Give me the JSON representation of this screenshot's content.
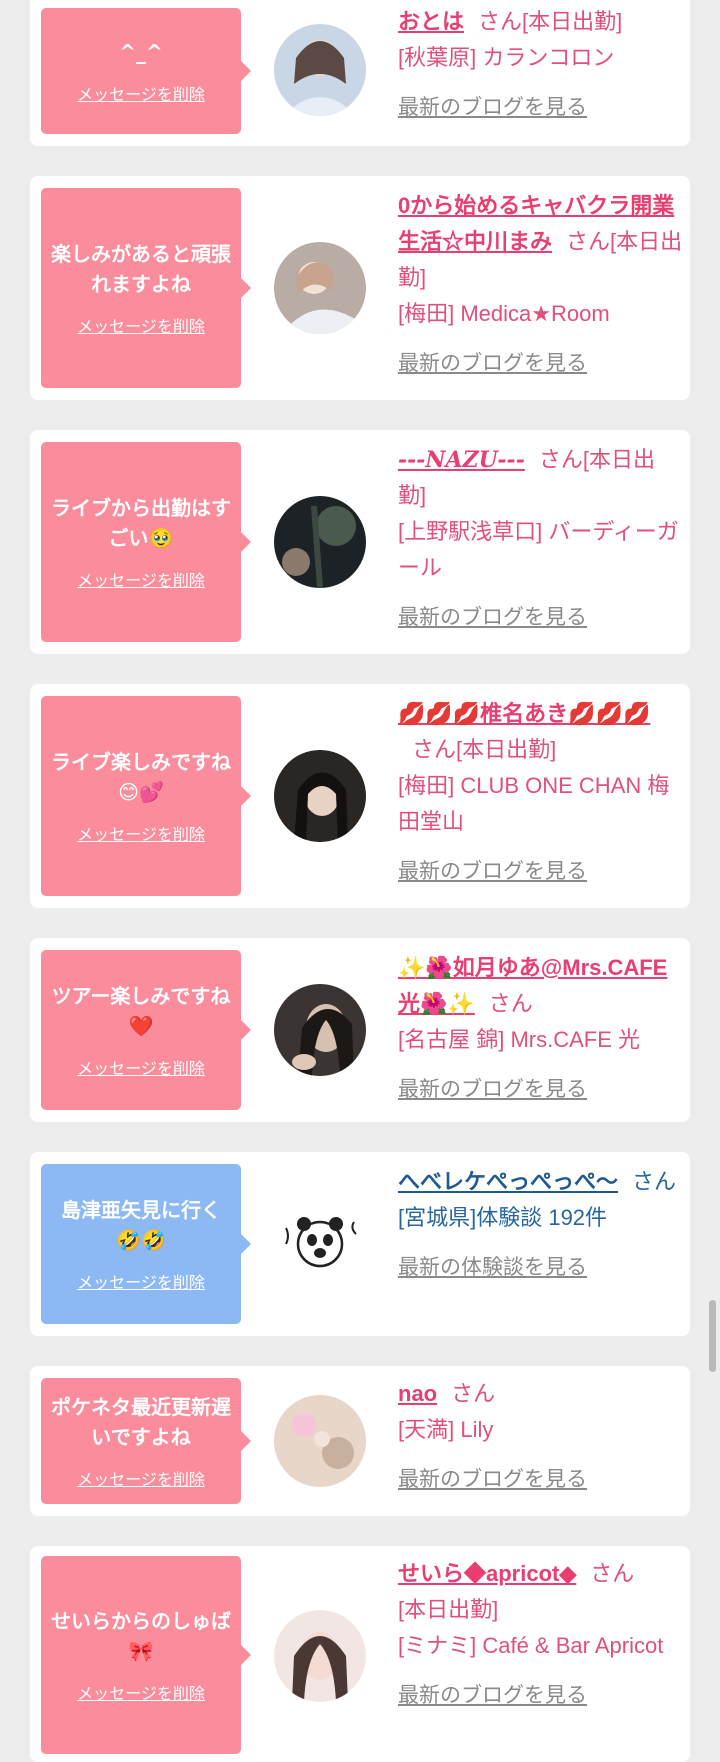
{
  "delete_label": "メッセージを削除",
  "san_label": "さん",
  "blog_link_label": "最新のブログを見る",
  "review_link_label": "最新の体験談を見る",
  "items": [
    {
      "message": "^_^",
      "name": "おとは",
      "status": "[本日出勤]",
      "shop": "[秋葉原] カランコロン"
    },
    {
      "message": "楽しみがあると頑張れますよね",
      "name": "0から始めるキャバクラ開業生活☆中川まみ",
      "status": "[本日出勤]",
      "shop": "[梅田] Medica★Room"
    },
    {
      "message": "ライブから出勤はすごい🥹",
      "name": "---NAZU---",
      "status": "[本日出勤]",
      "shop": "[上野駅浅草口] バーディーガール"
    },
    {
      "message": "ライブ楽しみですね😊💕",
      "name": "💋💋💋椎名あき💋💋💋",
      "status": "[本日出勤]",
      "shop": "[梅田] CLUB ONE CHAN 梅田堂山"
    },
    {
      "message": "ツアー楽しみですね❤️",
      "name": "✨🌺如月ゆあ@Mrs.CAFE光🌺✨",
      "status": "",
      "shop": "[名古屋 錦] Mrs.CAFE 光"
    },
    {
      "message": "島津亜矢見に行く🤣🤣",
      "name": "へべレケぺっぺっぺ〜",
      "status": "",
      "shop": "[宮城県]体験談 192件"
    },
    {
      "message": "ポケネタ最近更新遅いですよね",
      "name": "nao",
      "status": "",
      "shop": "[天満] Lily"
    },
    {
      "message": "せいらからのしゅば🎀",
      "name": "せいら◆apricot◆",
      "status": "[本日出勤]",
      "shop": "[ミナミ] Café & Bar Apricot"
    }
  ]
}
